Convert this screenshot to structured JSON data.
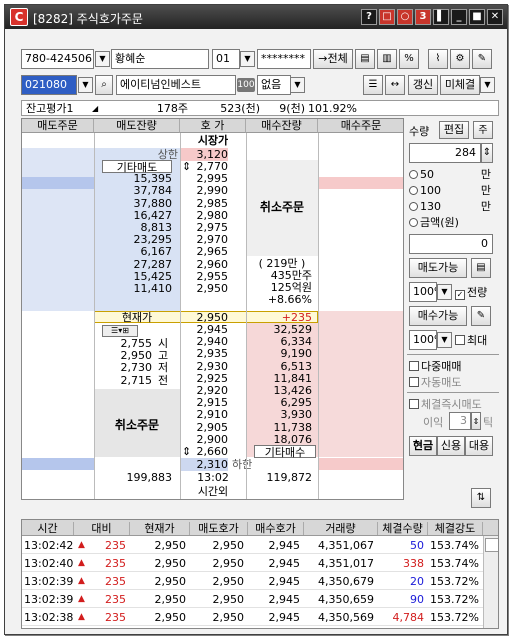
{
  "window": {
    "screen_id": "[8282]",
    "title": "주식호가주문"
  },
  "account": {
    "number": "780-424506",
    "holder": "황혜순",
    "suffix": "01",
    "password": "********",
    "all_btn": "→전체"
  },
  "stock": {
    "code": "021080",
    "name": "에이티넘인베스트",
    "badge": "100",
    "option": "없음",
    "refresh_btn": "갱신",
    "unfilled_btn": "미체결"
  },
  "evaluation": {
    "label": "잔고평가1",
    "qty": "178주",
    "amt1": "523(천)",
    "amt2": "9(천)",
    "rate": "101.92%"
  },
  "orderbook": {
    "headers": [
      "매도주문",
      "매도잔량",
      "호  가",
      "매수잔량",
      "매수주문"
    ],
    "market_price": "시장가",
    "upper_limit_label": "상한",
    "upper_limit": "3,120",
    "sell_other_label": "기타매도",
    "sell_cancel_label": "취소주문",
    "buy_cancel_label": "취소주문",
    "ask_prices": [
      "2,770",
      "2,995",
      "2,990",
      "2,985",
      "2,980",
      "2,975",
      "2,970",
      "2,965",
      "2,960",
      "2,955",
      "2,950"
    ],
    "ask_volumes": [
      "",
      "15,395",
      "37,784",
      "37,880",
      "16,427",
      "8,813",
      "23,295",
      "6,167",
      "27,287",
      "15,425",
      "11,410"
    ],
    "info": [
      "( 219만 )",
      "435만주",
      "125억원",
      "+8.66%"
    ],
    "current_label": "현재가",
    "current_price": "2,950",
    "current_change": "+235",
    "bid_prices": [
      "2,945",
      "2,940",
      "2,935",
      "2,930",
      "2,925",
      "2,920",
      "2,915",
      "2,910",
      "2,905",
      "2,900",
      "2,660"
    ],
    "bid_volumes": [
      "32,529",
      "6,334",
      "9,190",
      "6,513",
      "11,841",
      "13,426",
      "6,295",
      "3,930",
      "11,738",
      "18,076",
      ""
    ],
    "buy_other_label": "기타매수",
    "ohlc": [
      {
        "v": "2,755",
        "l": "시"
      },
      {
        "v": "2,950",
        "l": "고"
      },
      {
        "v": "2,730",
        "l": "저"
      },
      {
        "v": "2,715",
        "l": "전"
      }
    ],
    "lower_limit": "2,310",
    "lower_limit_label": "하한",
    "total_ask": "199,883",
    "time": "13:02",
    "total_bid": "119,872",
    "after_hours": "시간외"
  },
  "side": {
    "qty_label": "수량",
    "edit_btn": "편집",
    "qty_value": "284",
    "radios": [
      {
        "v": "50",
        "u": "만"
      },
      {
        "v": "100",
        "u": "만"
      },
      {
        "v": "130",
        "u": "만"
      },
      {
        "v": "금액(원)",
        "u": ""
      }
    ],
    "amount": "0",
    "sell_possible": "매도가능",
    "pct1": "100%",
    "all_chk": "전량",
    "buy_possible": "매수가능",
    "pct2": "100%",
    "max_chk": "최대",
    "multi_order": "다중매매",
    "auto_sell": "자동매도",
    "fill_sell": "체결즉시매도",
    "ticks_label": "이익",
    "ticks_value": "3",
    "ticks_unit": "틱",
    "cash_btn": "현금",
    "credit_btn": "신용",
    "loan_btn": "대용"
  },
  "trades": {
    "headers": [
      "시간",
      "대비",
      "현재가",
      "매도호가",
      "매수호가",
      "거래량",
      "체결수량",
      "체결강도"
    ],
    "rows": [
      [
        "13:02:42",
        "235",
        "2,950",
        "2,950",
        "2,945",
        "4,351,067",
        "50",
        "153.74%"
      ],
      [
        "13:02:40",
        "235",
        "2,950",
        "2,950",
        "2,945",
        "4,351,017",
        "338",
        "153.74%"
      ],
      [
        "13:02:39",
        "235",
        "2,950",
        "2,950",
        "2,945",
        "4,350,679",
        "20",
        "153.72%"
      ],
      [
        "13:02:39",
        "235",
        "2,950",
        "2,950",
        "2,945",
        "4,350,659",
        "90",
        "153.72%"
      ],
      [
        "13:02:38",
        "235",
        "2,950",
        "2,950",
        "2,945",
        "4,350,569",
        "4,784",
        "153.72%"
      ]
    ],
    "qty_colors": [
      "blue",
      "redt",
      "blue",
      "blue",
      "redt"
    ]
  },
  "colors": {
    "ask_bg": "#d8e2f4",
    "bid_bg": "#f6d8d8",
    "price_bg": "#ffffff",
    "accent_red": "#d21d1d",
    "accent_blue": "#1a1ad8"
  }
}
